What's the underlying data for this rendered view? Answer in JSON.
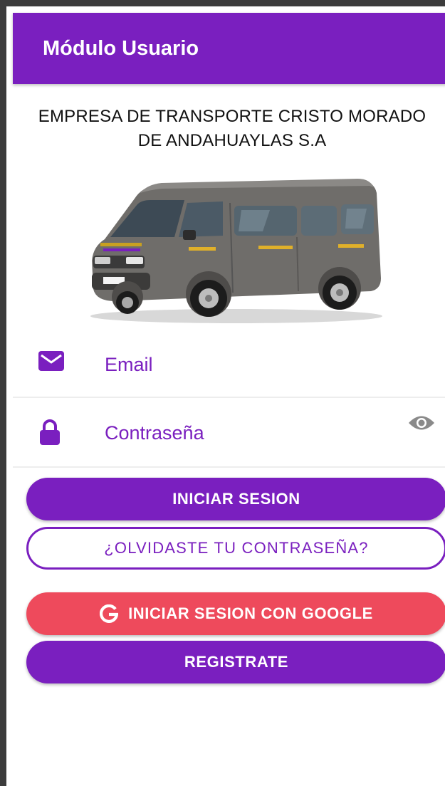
{
  "app_bar": {
    "title": "Módulo Usuario"
  },
  "company": {
    "line1": "EMPRESA DE TRANSPORTE CRISTO MORADO",
    "line2": "DE ANDAHUAYLAS S.A"
  },
  "hero_image": {
    "subject": "van"
  },
  "form": {
    "email": {
      "placeholder": "Email",
      "icon": "email-icon"
    },
    "password": {
      "placeholder": "Contraseña",
      "icon": "lock-icon",
      "toggle_icon": "eye-icon"
    }
  },
  "buttons": {
    "login": "INICIAR SESION",
    "forgot": "¿OLVIDASTE TU CONTRASEÑA?",
    "google": "INICIAR SESION CON GOOGLE",
    "register": "REGISTRATE"
  },
  "colors": {
    "primary": "#7a1fbf",
    "google": "#ee4a5c",
    "text_on_primary": "#ffffff"
  }
}
